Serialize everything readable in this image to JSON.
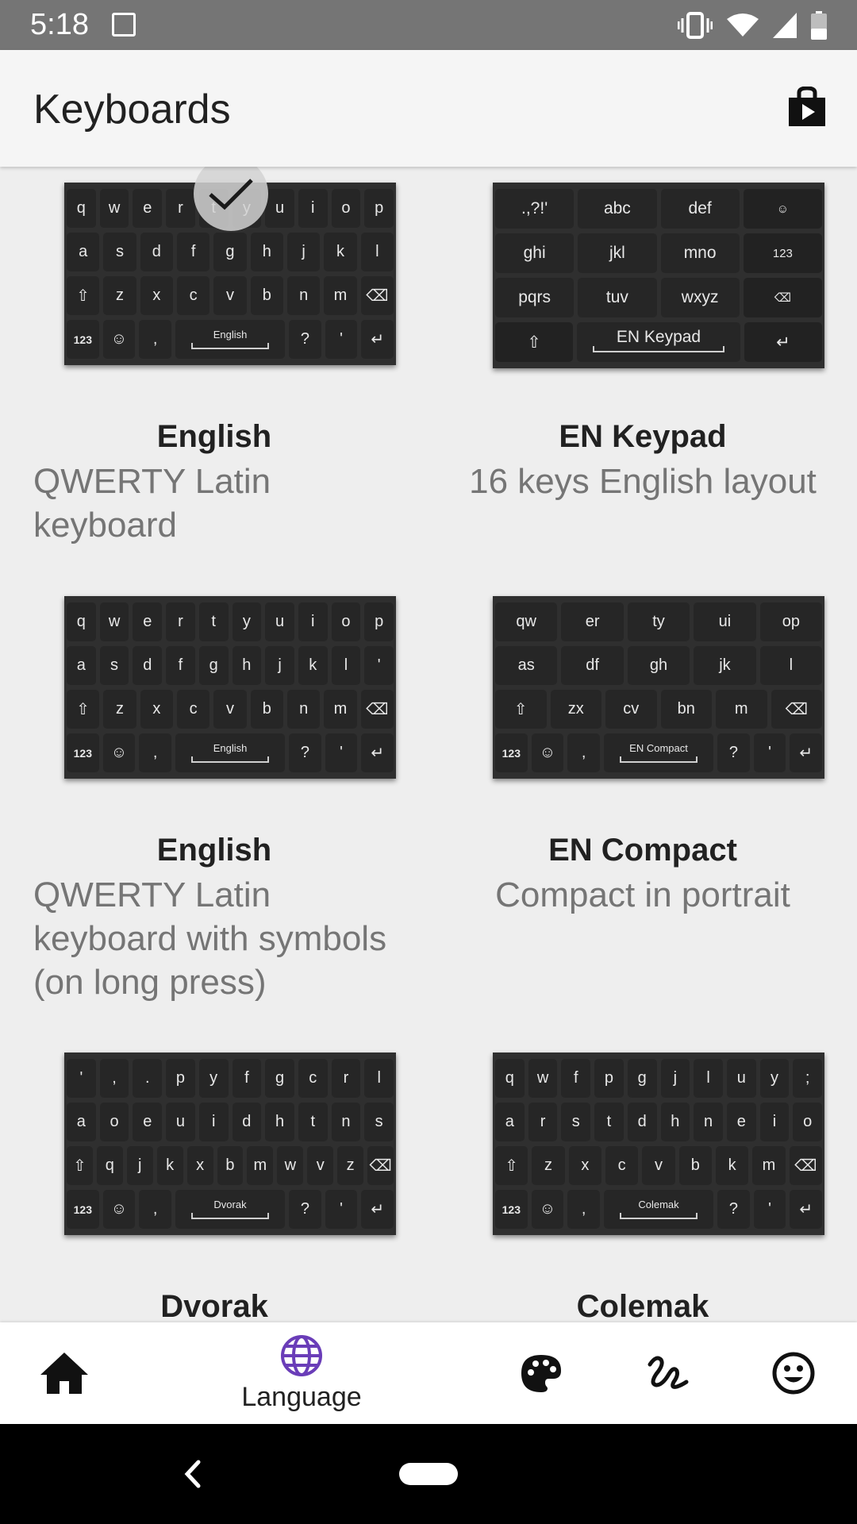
{
  "status_bar": {
    "time": "5:18"
  },
  "app_bar": {
    "title": "Keyboards"
  },
  "cards": [
    {
      "title": "English",
      "description": "QWERTY Latin keyboard",
      "selected": true,
      "rows": [
        [
          "q",
          "w",
          "e",
          "r",
          "t",
          "y",
          "u",
          "i",
          "o",
          "p"
        ],
        [
          "a",
          "s",
          "d",
          "f",
          "g",
          "h",
          "j",
          "k",
          "l"
        ],
        [
          "⇧",
          "z",
          "x",
          "c",
          "v",
          "b",
          "n",
          "m",
          "⌫"
        ]
      ],
      "space_label": "English"
    },
    {
      "title": "EN Keypad",
      "description": "16 keys English layout",
      "rows": [
        [
          ".,?!'",
          "abc",
          "def",
          "☺"
        ],
        [
          "ghi",
          "jkl",
          "mno",
          "123"
        ],
        [
          "pqrs",
          "tuv",
          "wxyz",
          "⌫"
        ]
      ],
      "space_label": "EN Keypad"
    },
    {
      "title": "English",
      "description": "QWERTY Latin keyboard with symbols (on long press)",
      "rows": [
        [
          "q",
          "w",
          "e",
          "r",
          "t",
          "y",
          "u",
          "i",
          "o",
          "p"
        ],
        [
          "a",
          "s",
          "d",
          "f",
          "g",
          "h",
          "j",
          "k",
          "l",
          "'"
        ],
        [
          "⇧",
          "z",
          "x",
          "c",
          "v",
          "b",
          "n",
          "m",
          "⌫"
        ]
      ],
      "space_label": "English"
    },
    {
      "title": "EN Compact",
      "description": "Compact in portrait",
      "rows": [
        [
          "qw",
          "er",
          "ty",
          "ui",
          "op"
        ],
        [
          "as",
          "df",
          "gh",
          "jk",
          "l"
        ],
        [
          "⇧",
          "zx",
          "cv",
          "bn",
          "m",
          "⌫"
        ]
      ],
      "space_label": "EN Compact"
    },
    {
      "title": "Dvorak",
      "description": "",
      "rows": [
        [
          "'",
          ",",
          ".",
          "p",
          "y",
          "f",
          "g",
          "c",
          "r",
          "l"
        ],
        [
          "a",
          "o",
          "e",
          "u",
          "i",
          "d",
          "h",
          "t",
          "n",
          "s"
        ],
        [
          "⇧",
          "q",
          "j",
          "k",
          "x",
          "b",
          "m",
          "w",
          "v",
          "z",
          "⌫"
        ]
      ],
      "space_label": "Dvorak"
    },
    {
      "title": "Colemak",
      "description": "",
      "rows": [
        [
          "q",
          "w",
          "f",
          "p",
          "g",
          "j",
          "l",
          "u",
          "y",
          ";"
        ],
        [
          "a",
          "r",
          "s",
          "t",
          "d",
          "h",
          "n",
          "e",
          "i",
          "o"
        ],
        [
          "⇧",
          "z",
          "x",
          "c",
          "v",
          "b",
          "k",
          "m",
          "⌫"
        ]
      ],
      "space_label": "Colemak"
    }
  ],
  "bottom_row": {
    "n123": "123",
    "emoji": "☺",
    "comma": ",",
    "question": "?",
    "apostrophe": "'",
    "enter": "↵"
  },
  "bottom_nav": {
    "items": [
      {
        "icon": "home-icon"
      },
      {
        "icon": "language-globe-icon",
        "label": "Language",
        "active": true
      },
      {
        "icon": "palette-icon"
      },
      {
        "icon": "gesture-icon"
      },
      {
        "icon": "emoji-icon"
      }
    ],
    "accent_color": "#6a3db8"
  }
}
